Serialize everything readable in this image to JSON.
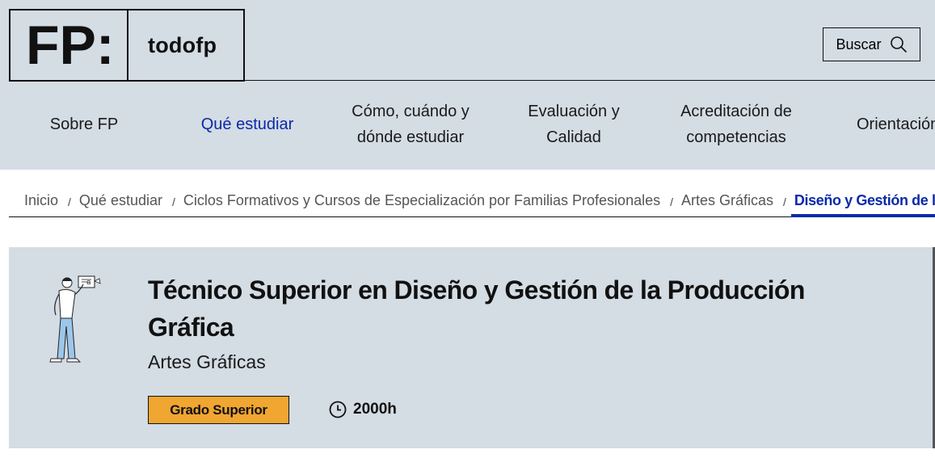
{
  "header": {
    "logo_mark": "FP:",
    "logo_text": "todofp",
    "search_label": "Buscar"
  },
  "nav": [
    {
      "label": "Sobre FP",
      "active": false
    },
    {
      "label": "Qué estudiar",
      "active": true
    },
    {
      "label": "Cómo, cuándo y dónde estudiar",
      "active": false
    },
    {
      "label": "Evaluación y Calidad",
      "active": false
    },
    {
      "label": "Acreditación de competencias",
      "active": false
    },
    {
      "label": "Orientación",
      "active": false
    }
  ],
  "breadcrumb": {
    "separator": "/",
    "items": [
      "Inicio",
      "Qué estudiar",
      "Ciclos Formativos y Cursos de Especialización por Familias Profesionales",
      "Artes Gráficas"
    ],
    "current": "Diseño y Gestión de la"
  },
  "hero": {
    "title": "Técnico Superior en Diseño y Gestión de la Producción Gráfica",
    "family": "Artes Gráficas",
    "level_badge": "Grado Superior",
    "duration": "2000h",
    "illustration_icon": "person-holding-document-illustration",
    "duration_icon": "clock-icon"
  },
  "colors": {
    "header_bg": "#d4dce4",
    "accent": "#0b2aa8",
    "badge": "#f0a631"
  }
}
